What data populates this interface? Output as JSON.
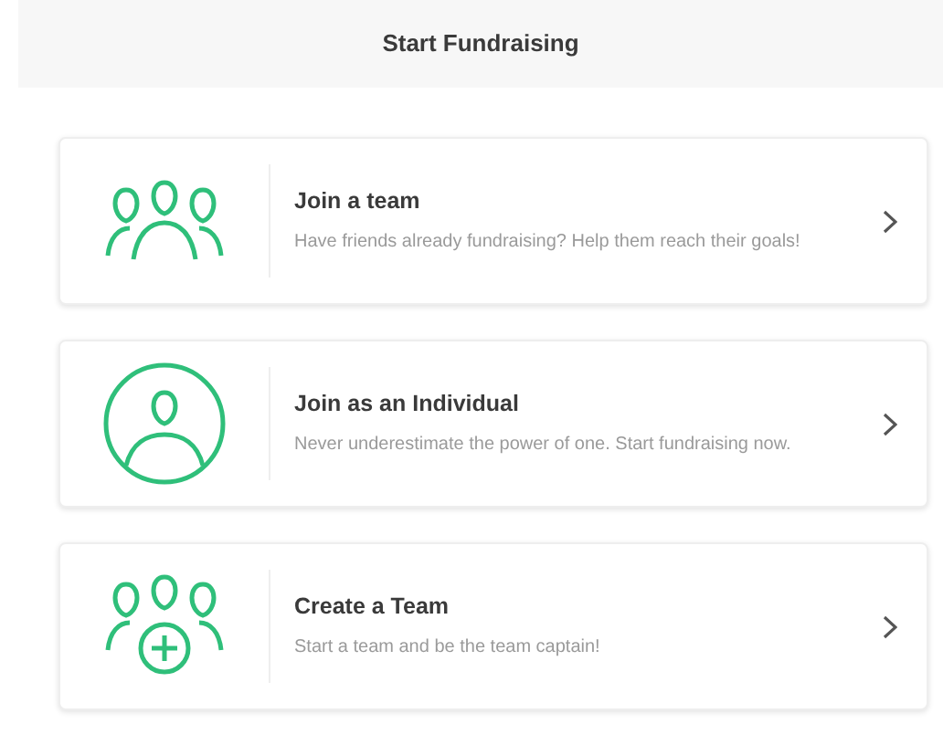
{
  "header": {
    "title": "Start Fundraising"
  },
  "options": [
    {
      "kind": "group",
      "title": "Join a team",
      "description": "Have friends already fundraising? Help them reach their goals!"
    },
    {
      "kind": "person",
      "title": "Join as an Individual",
      "description": "Never underestimate the power of one. Start fundraising now."
    },
    {
      "kind": "group-plus",
      "title": "Create a Team",
      "description": "Start a team and be the team captain!"
    }
  ]
}
